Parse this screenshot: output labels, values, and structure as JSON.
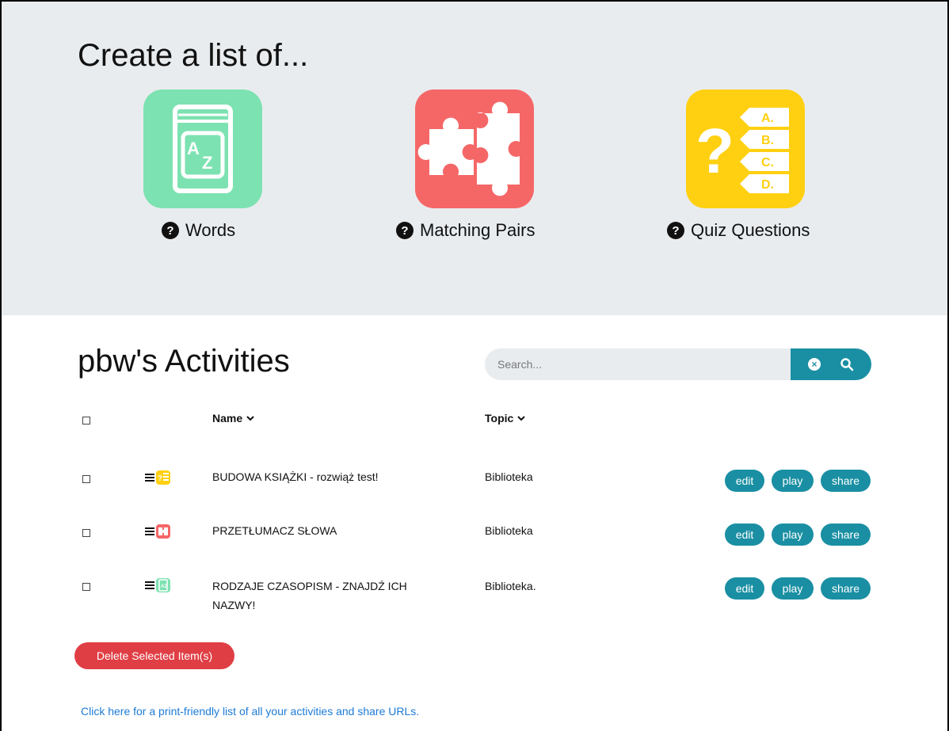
{
  "create": {
    "title": "Create a list of...",
    "tiles": [
      {
        "label": "Words",
        "icon": "book-az-icon",
        "color": "#7de2b1"
      },
      {
        "label": "Matching Pairs",
        "icon": "puzzle-icon",
        "color": "#f56767"
      },
      {
        "label": "Quiz Questions",
        "icon": "quiz-abcd-icon",
        "color": "#ffd011"
      }
    ],
    "help_icon": "?"
  },
  "activities": {
    "title": "pbw's Activities",
    "search": {
      "placeholder": "Search..."
    },
    "columns": {
      "name": "Name",
      "topic": "Topic"
    },
    "rows": [
      {
        "name": "BUDOWA KSIĄŻKI - rozwiąż test!",
        "name_line2": "",
        "topic": "Biblioteka",
        "type_icon": "quiz-abcd-icon"
      },
      {
        "name": "PRZETŁUMACZ SŁOWA",
        "name_line2": "",
        "topic": "Biblioteka",
        "type_icon": "puzzle-icon"
      },
      {
        "name": "RODZAJE CZASOPISM - ZNAJDŹ ICH",
        "name_line2": "NAZWY!",
        "topic": "Biblioteka.",
        "type_icon": "book-az-icon"
      }
    ],
    "actions": {
      "edit": "edit",
      "play": "play",
      "share": "share"
    },
    "delete_label": "Delete Selected Item(s)",
    "print_link": "Click here for a print-friendly list of all your activities and share URLs."
  },
  "colors": {
    "accent": "#1a8fa3",
    "danger": "#e03e45",
    "link": "#1e7bd6",
    "header_bg": "#e9ecef"
  }
}
